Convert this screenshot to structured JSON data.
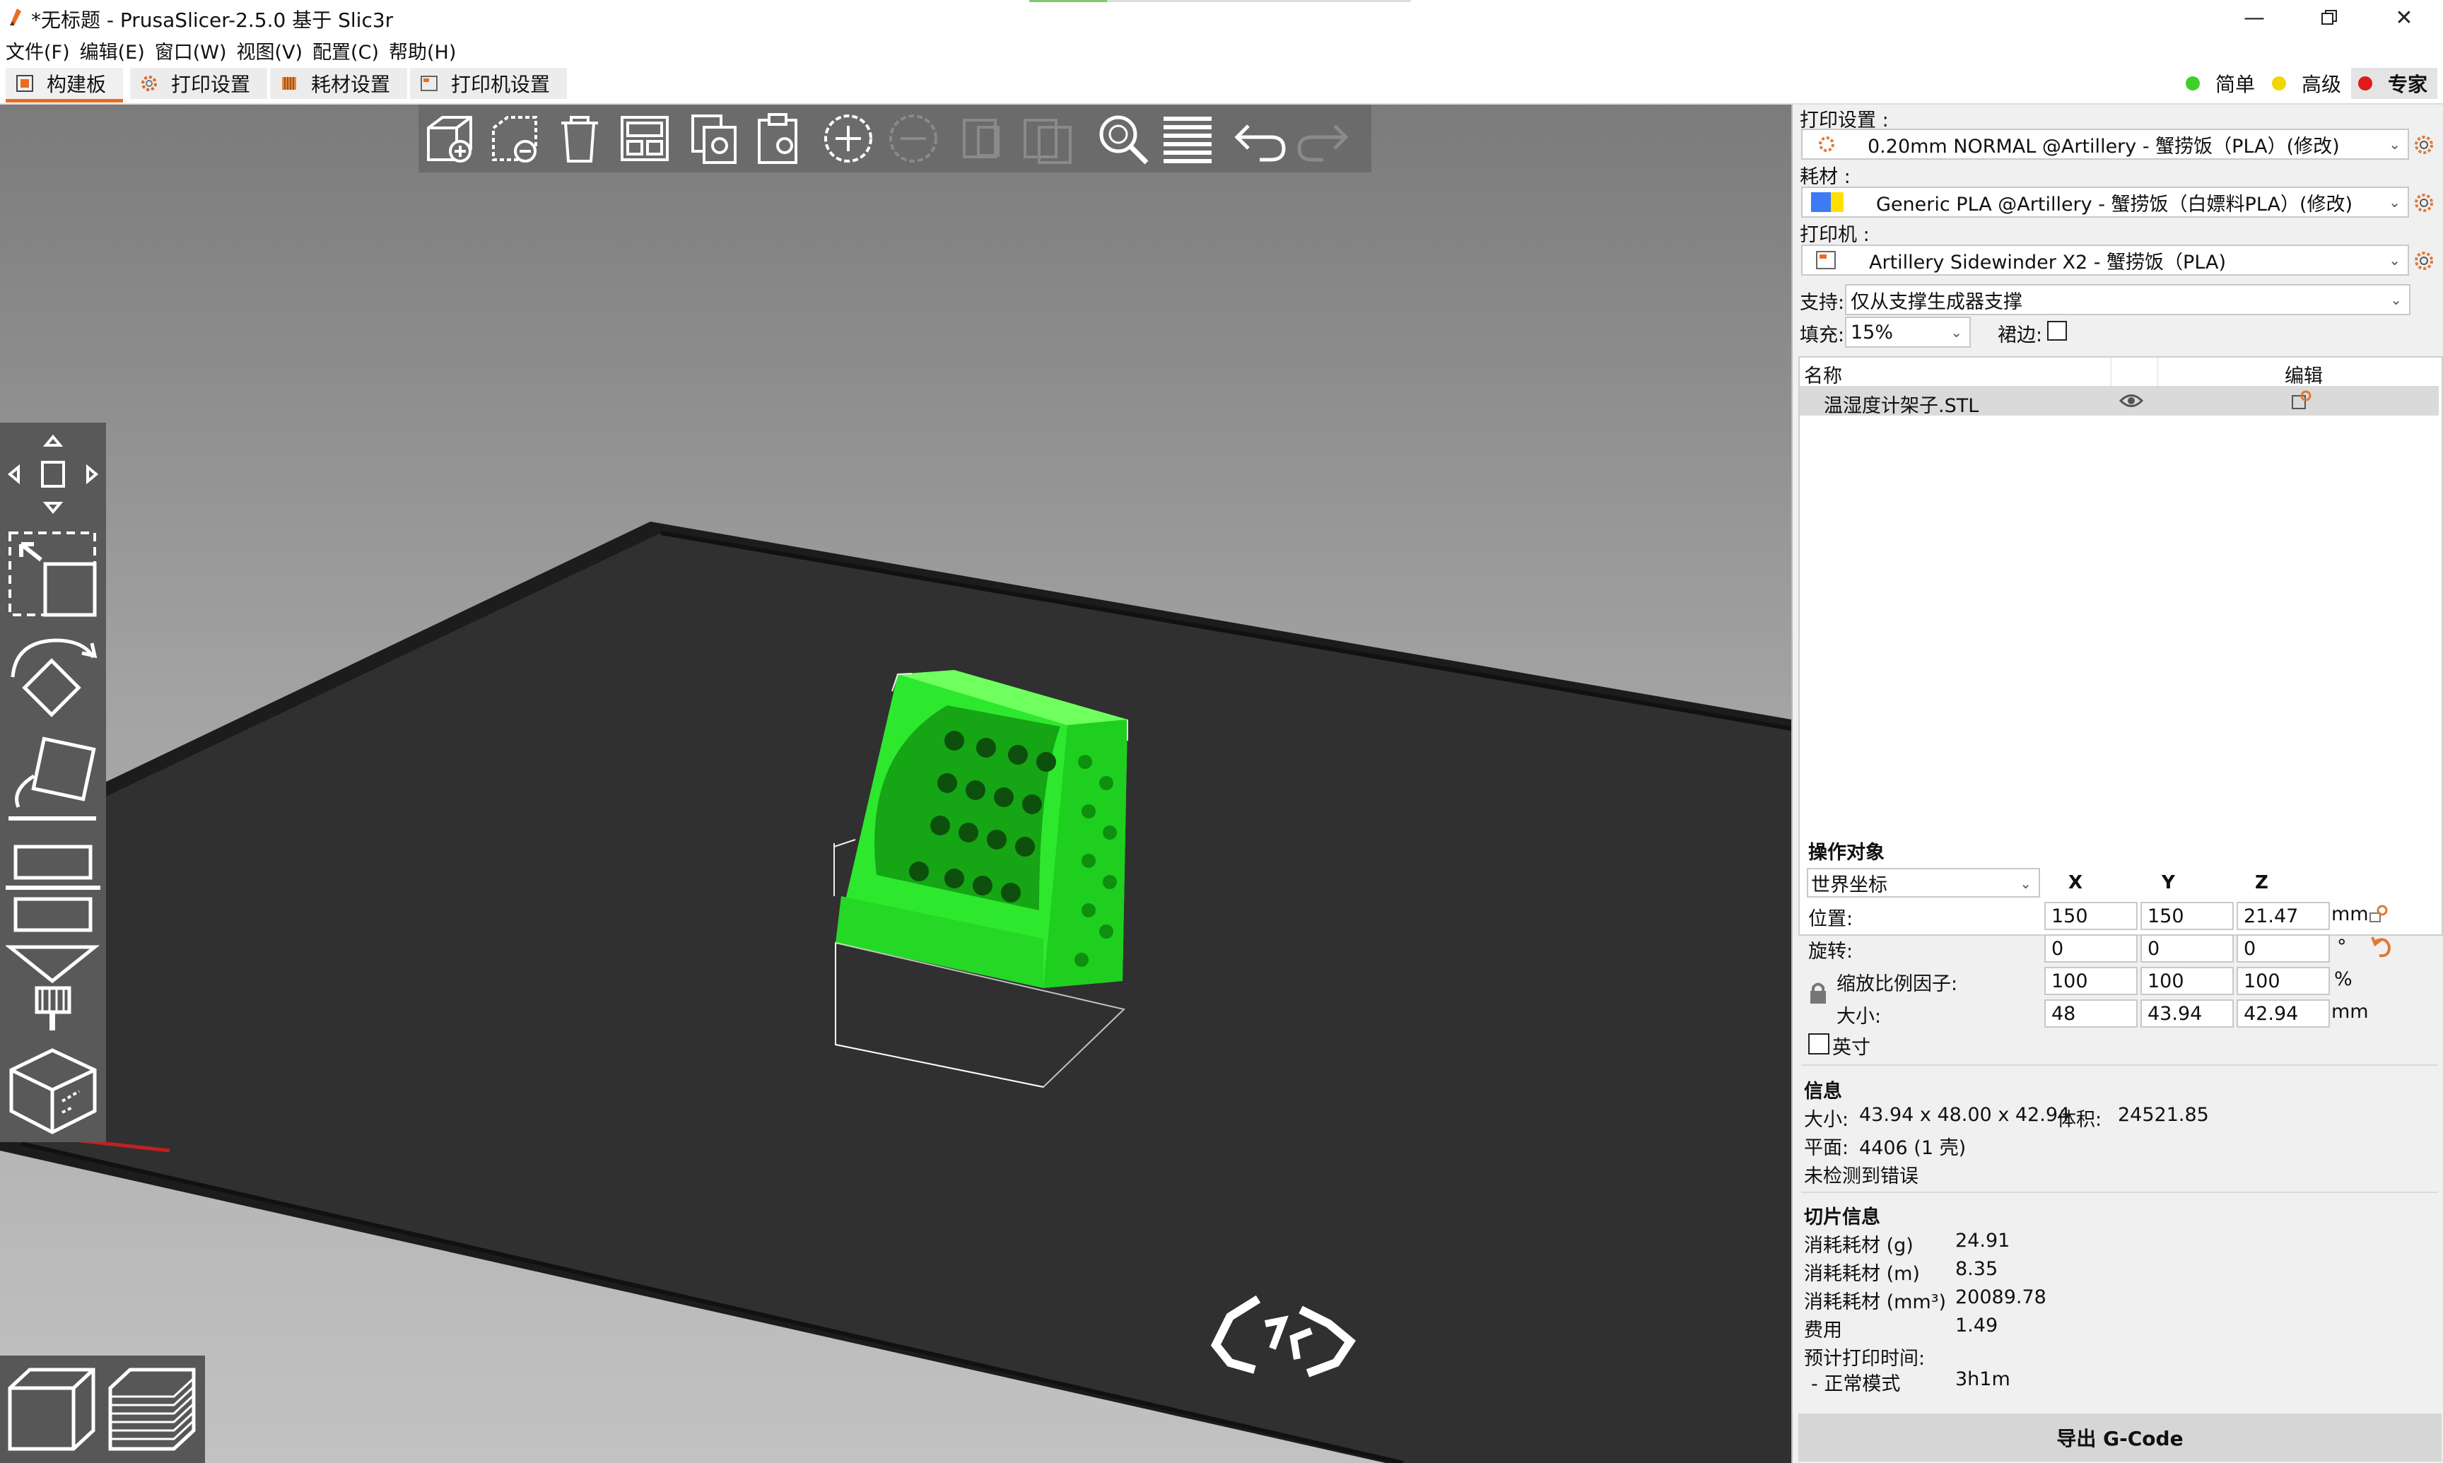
{
  "window": {
    "title": "*无标题 - PrusaSlicer-2.5.0 基于 Slic3r",
    "controls": [
      "minimize-icon",
      "restore-icon",
      "close-icon"
    ]
  },
  "menu": [
    "文件(F)",
    "编辑(E)",
    "窗口(W)",
    "视图(V)",
    "配置(C)",
    "帮助(H)"
  ],
  "tabs": [
    {
      "label": "构建板",
      "icon": "plater-icon",
      "active": true
    },
    {
      "label": "打印设置",
      "icon": "gear-icon",
      "active": false
    },
    {
      "label": "耗材设置",
      "icon": "spool-icon",
      "active": false
    },
    {
      "label": "打印机设置",
      "icon": "printer-icon",
      "active": false
    }
  ],
  "modes": [
    {
      "label": "简单",
      "color": "#3fcf2b"
    },
    {
      "label": "高级",
      "color": "#f2d600"
    },
    {
      "label": "专家",
      "color": "#e01a1a",
      "active": true
    }
  ],
  "toolbar_icons": [
    "add-icon",
    "delete-icon",
    "delete-all-icon",
    "arrange-icon",
    "copy-icon",
    "paste-icon",
    "add-instance-icon",
    "remove-instance-icon",
    "split-objects-icon",
    "split-parts-icon",
    "search-icon",
    "layers-editing-icon",
    "undo-icon",
    "redo-icon"
  ],
  "left_tools": [
    "move-icon",
    "scale-icon",
    "rotate-icon",
    "place-on-face-icon",
    "cut-icon",
    "hollow-icon",
    "support-paint-icon",
    "seam-paint-icon"
  ],
  "view_buttons": [
    "3d-view-icon",
    "preview-icon"
  ],
  "sidebar": {
    "print_settings": {
      "label": "打印设置 :",
      "value": "0.20mm NORMAL @Artillery - 蟹捞饭（PLA）(修改)"
    },
    "filament": {
      "label": "耗材 :",
      "value": "Generic PLA @Artillery - 蟹捞饭（白嫖料PLA）(修改)",
      "colors": [
        "#3d7bf5",
        "#ffe000"
      ]
    },
    "printer": {
      "label": "打印机 :",
      "value": "Artillery Sidewinder X2 - 蟹捞饭（PLA)"
    },
    "support": {
      "label": "支持:",
      "value": "仅从支撑生成器支撑"
    },
    "infill": {
      "label": "填充:",
      "value": "15%"
    },
    "brim": {
      "label": "裙边:",
      "checked": false
    },
    "object_list": {
      "headers": [
        "名称",
        "编辑"
      ],
      "rows": [
        {
          "name": "温湿度计架子.STL"
        }
      ]
    },
    "manipulation": {
      "title": "操作对象",
      "coords": "世界坐标",
      "axes": [
        "X",
        "Y",
        "Z"
      ],
      "rows": [
        {
          "label": "位置:",
          "values": [
            "150",
            "150",
            "21.47"
          ],
          "unit": "mm"
        },
        {
          "label": "旋转:",
          "values": [
            "0",
            "0",
            "0"
          ],
          "unit": "°"
        },
        {
          "label": "缩放比例因子:",
          "values": [
            "100",
            "100",
            "100"
          ],
          "unit": "%"
        },
        {
          "label": "大小:",
          "values": [
            "48",
            "43.94",
            "42.94"
          ],
          "unit": "mm"
        }
      ],
      "inches_label": "英寸"
    },
    "info": {
      "title": "信息",
      "size_label": "大小:",
      "size_value": "43.94 x 48.00 x 42.94",
      "volume_label": "体积:",
      "volume_value": "24521.85",
      "facets_label": "平面:",
      "facets_value": "4406 (1 壳)",
      "errors": "未检测到错误"
    },
    "sliced": {
      "title": "切片信息",
      "rows": [
        {
          "label": "消耗耗材 (g)",
          "value": "24.91"
        },
        {
          "label": "消耗耗材 (m)",
          "value": "8.35"
        },
        {
          "label": "消耗耗材 (mm³)",
          "value": "20089.78"
        },
        {
          "label": "费用",
          "value": "1.49"
        }
      ],
      "time_label": "预计打印时间:",
      "mode_label": "- 正常模式",
      "mode_value": "3h1m"
    },
    "export_button": "导出 G-Code"
  }
}
